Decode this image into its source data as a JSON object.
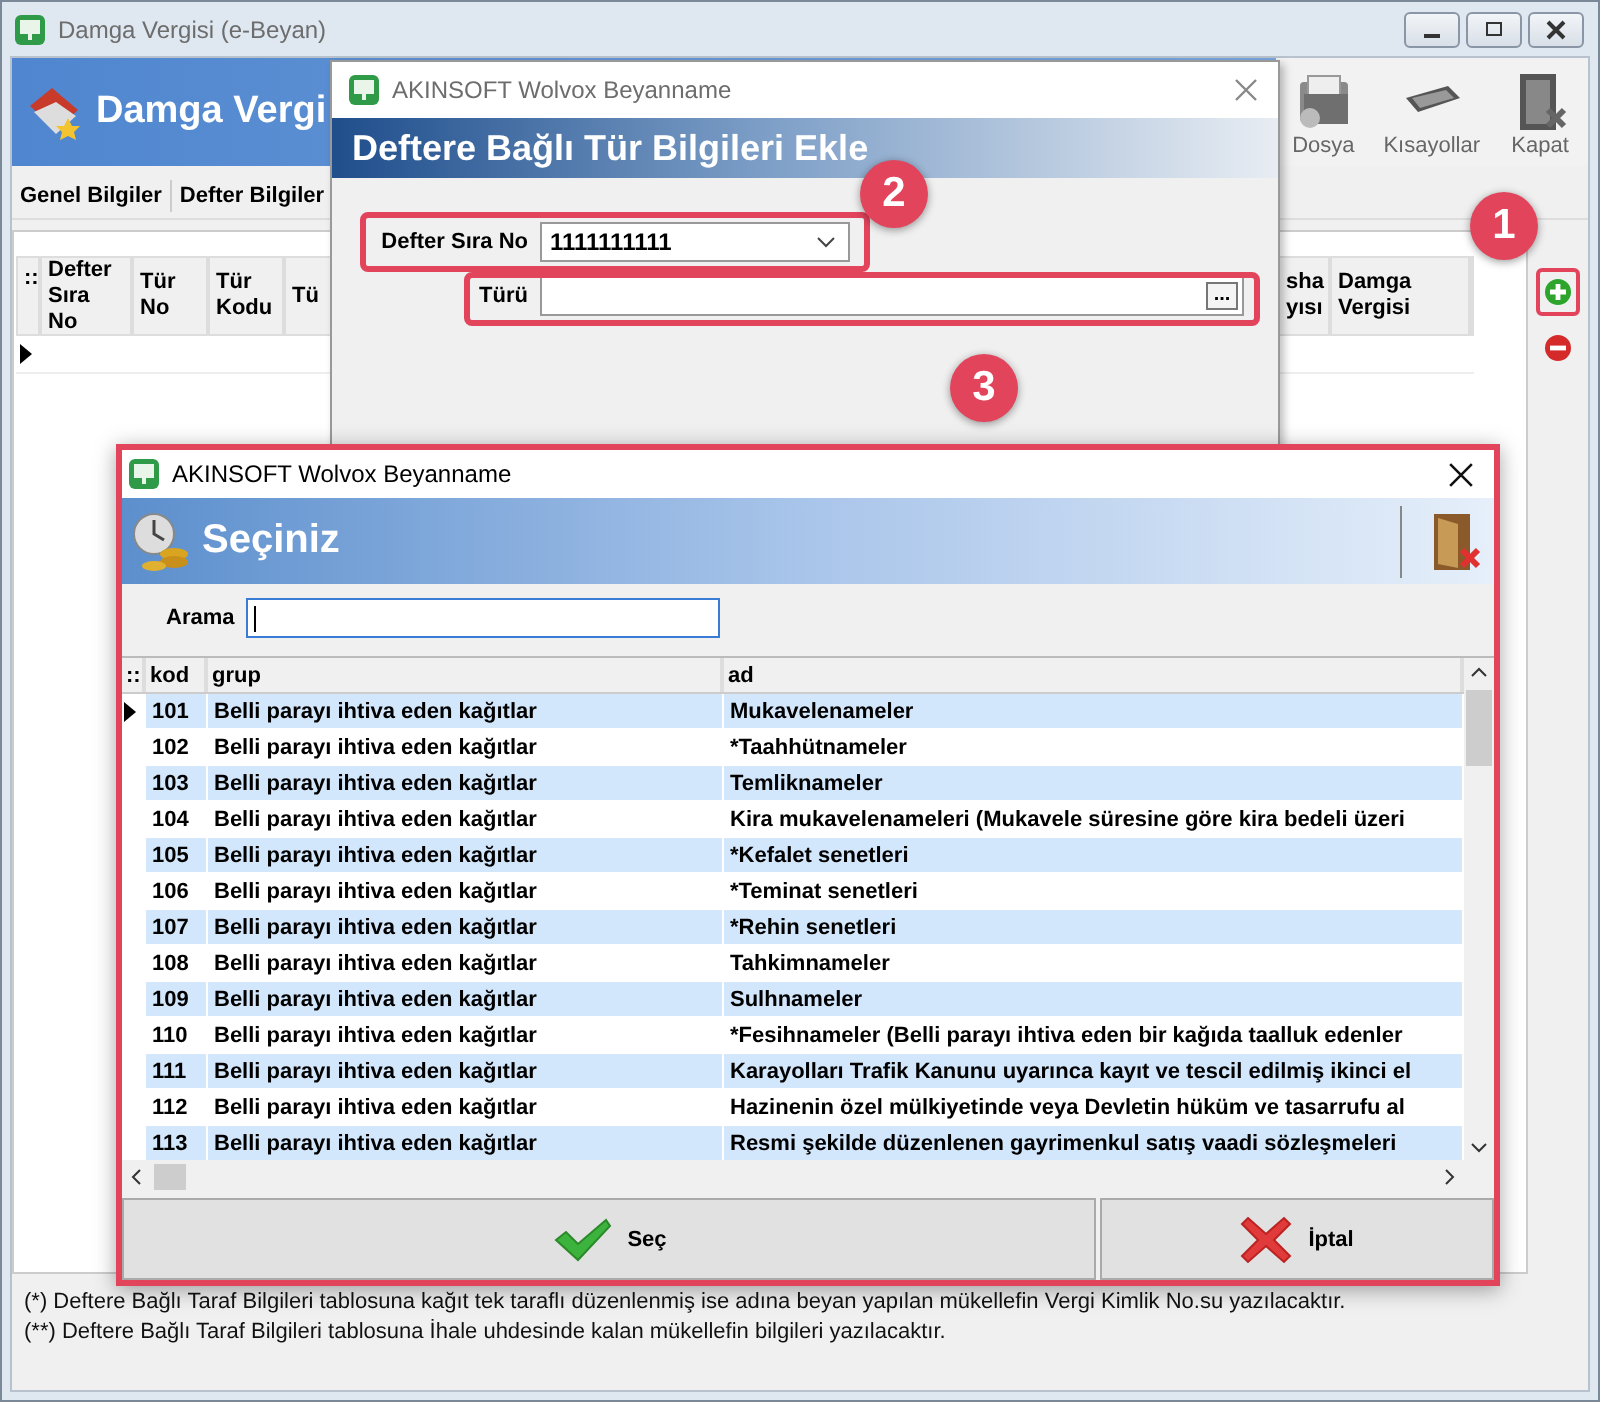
{
  "main_window": {
    "title": "Damga Vergisi (e-Beyan)",
    "header_title": "Damga Vergi",
    "toolbar": [
      {
        "label": "Dosya",
        "kind": "folder"
      },
      {
        "label": "Kısayollar",
        "kind": "keyboard"
      },
      {
        "label": "Kapat",
        "kind": "exit"
      }
    ],
    "tabs": [
      {
        "label": "Genel Bilgiler"
      },
      {
        "label": "Defter Bilgiler"
      }
    ],
    "grid": {
      "corner": "::",
      "columns_left": [
        "Defter Sıra No",
        "Tür No",
        "Tür Kodu",
        "Tü"
      ],
      "columns_right": [
        "sha yısı",
        "Damga Vergisi"
      ]
    },
    "side_buttons": [
      {
        "kind": "add",
        "highlighted": true
      },
      {
        "kind": "remove",
        "highlighted": false
      }
    ],
    "notes": [
      "(*) Deftere Bağlı Taraf Bilgileri tablosuna kağıt tek taraflı düzenlenmiş ise adına beyan yapılan mükellefin Vergi Kimlik No.su yazılacaktır.",
      "(**) Deftere Bağlı Taraf Bilgileri tablosuna İhale uhdesinde kalan mükellefin bilgileri yazılacaktır."
    ]
  },
  "entry_dialog": {
    "title": "AKINSOFT Wolvox Beyanname",
    "header": "Deftere Bağlı Tür Bilgileri Ekle",
    "fields": [
      {
        "label": "Defter Sıra No",
        "kind": "dropdown",
        "value": "1111111111",
        "highlighted": true
      },
      {
        "label": "Türü",
        "kind": "lookup",
        "button": "...",
        "highlighted": true
      }
    ]
  },
  "pick_dialog": {
    "title": "AKINSOFT Wolvox Beyanname",
    "header": "Seçiniz",
    "highlighted": true,
    "search": {
      "label": "Arama"
    },
    "table": {
      "corner": "::",
      "columns": [
        "kod",
        "grup",
        "ad"
      ],
      "rows": [
        {
          "kod": "101",
          "grup": "Belli parayı ihtiva eden kağıtlar",
          "ad": "Mukavelenameler",
          "selected": true
        },
        {
          "kod": "102",
          "grup": "Belli parayı ihtiva eden kağıtlar",
          "ad": "*Taahhütnameler",
          "selected": false
        },
        {
          "kod": "103",
          "grup": "Belli parayı ihtiva eden kağıtlar",
          "ad": "Temliknameler",
          "selected": false
        },
        {
          "kod": "104",
          "grup": "Belli parayı ihtiva eden kağıtlar",
          "ad": "Kira mukavelenameleri (Mukavele süresine göre kira bedeli üzeri",
          "selected": false
        },
        {
          "kod": "105",
          "grup": "Belli parayı ihtiva eden kağıtlar",
          "ad": "*Kefalet senetleri",
          "selected": false
        },
        {
          "kod": "106",
          "grup": "Belli parayı ihtiva eden kağıtlar",
          "ad": "*Teminat senetleri",
          "selected": false
        },
        {
          "kod": "107",
          "grup": "Belli parayı ihtiva eden kağıtlar",
          "ad": "*Rehin senetleri",
          "selected": false
        },
        {
          "kod": "108",
          "grup": "Belli parayı ihtiva eden kağıtlar",
          "ad": "Tahkimnameler",
          "selected": false
        },
        {
          "kod": "109",
          "grup": "Belli parayı ihtiva eden kağıtlar",
          "ad": "Sulhnameler",
          "selected": false
        },
        {
          "kod": "110",
          "grup": "Belli parayı ihtiva eden kağıtlar",
          "ad": "*Fesihnameler (Belli parayı ihtiva eden bir kağıda taalluk edenler",
          "selected": false
        },
        {
          "kod": "111",
          "grup": "Belli parayı ihtiva eden kağıtlar",
          "ad": "Karayolları Trafik Kanunu uyarınca kayıt ve tescil edilmiş ikinci el",
          "selected": false
        },
        {
          "kod": "112",
          "grup": "Belli parayı ihtiva eden kağıtlar",
          "ad": "Hazinenin özel mülkiyetinde veya Devletin hüküm ve tasarrufu al",
          "selected": false
        },
        {
          "kod": "113",
          "grup": "Belli parayı ihtiva eden kağıtlar",
          "ad": "Resmi şekilde düzenlenen gayrimenkul satış vaadi sözleşmeleri",
          "selected": false
        }
      ]
    },
    "buttons": [
      {
        "label": "Seç",
        "kind": "ok"
      },
      {
        "label": "İptal",
        "kind": "cancel"
      }
    ]
  },
  "callouts": [
    "1",
    "2",
    "3"
  ]
}
